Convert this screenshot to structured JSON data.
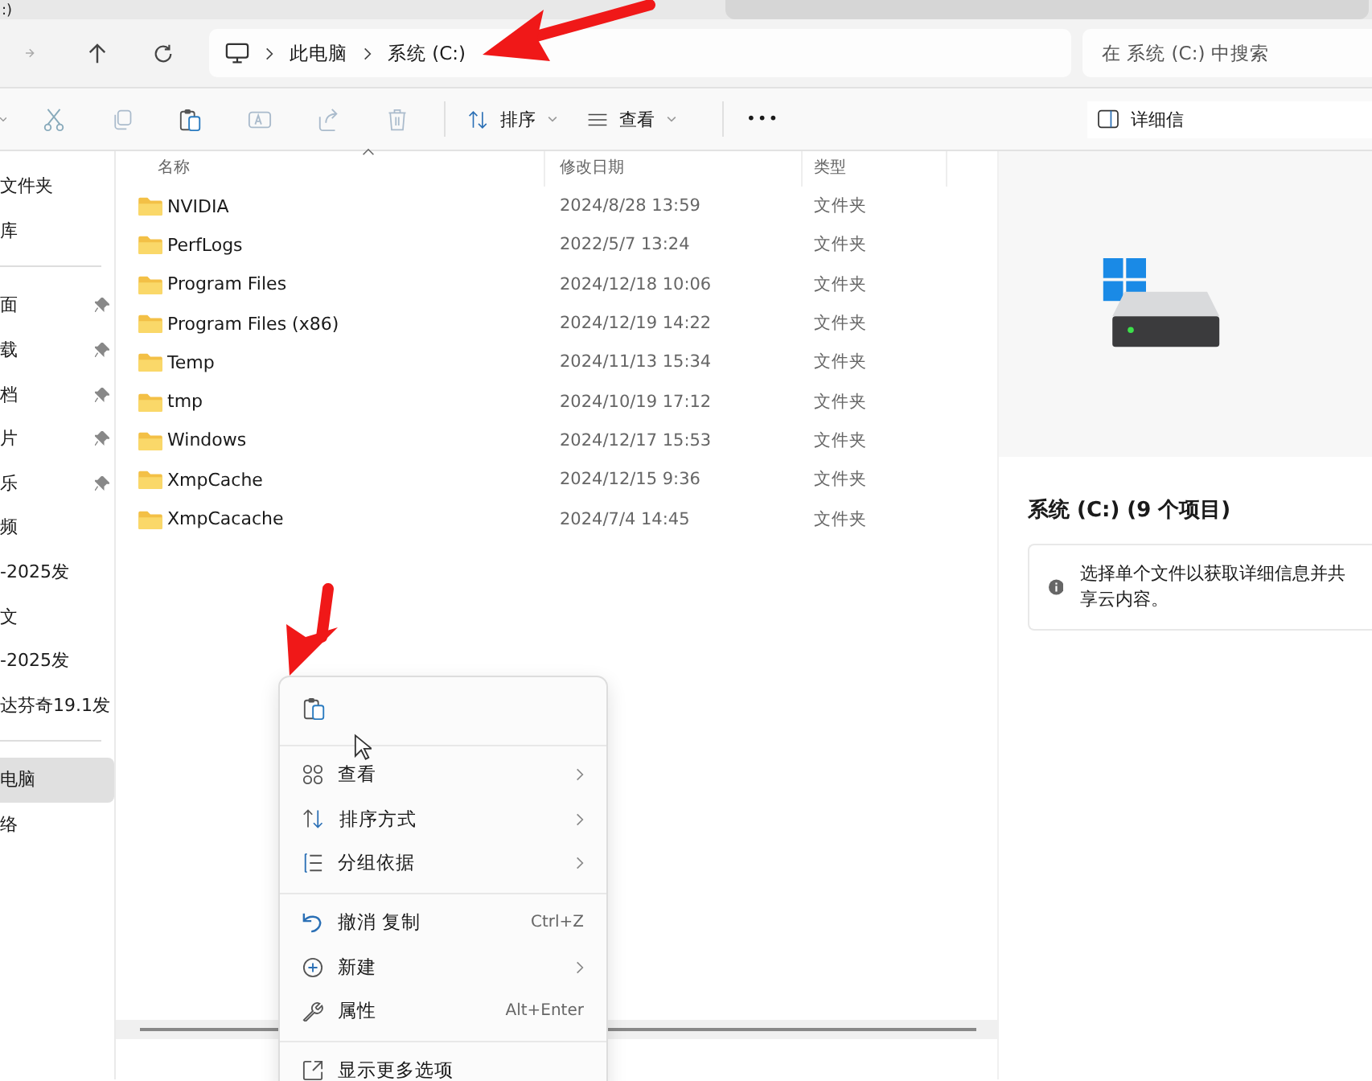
{
  "window": {
    "tab_title": ":)"
  },
  "address_bar": {
    "crumbs": [
      "此电脑",
      "系统 (C:)"
    ]
  },
  "search": {
    "placeholder": "在 系统 (C:) 中搜索"
  },
  "toolbar": {
    "sort": "排序",
    "view": "查看",
    "more": "•••",
    "details": "详细信"
  },
  "sidebar": {
    "sections": [
      [
        {
          "label": "文件夹",
          "pinned": false,
          "selected": false
        },
        {
          "label": "库",
          "pinned": false,
          "selected": false
        }
      ],
      [
        {
          "label": "面",
          "pinned": true,
          "selected": false
        },
        {
          "label": "载",
          "pinned": true,
          "selected": false
        },
        {
          "label": "档",
          "pinned": true,
          "selected": false
        },
        {
          "label": "片",
          "pinned": true,
          "selected": false
        },
        {
          "label": "乐",
          "pinned": true,
          "selected": false
        },
        {
          "label": "频",
          "pinned": false,
          "selected": false
        },
        {
          "label": "-2025发",
          "pinned": false,
          "selected": false
        },
        {
          "label": "文",
          "pinned": false,
          "selected": false
        },
        {
          "label": "-2025发",
          "pinned": false,
          "selected": false
        },
        {
          "label": "达芬奇19.1发",
          "pinned": false,
          "selected": false
        }
      ],
      [
        {
          "label": "电脑",
          "pinned": false,
          "selected": true
        },
        {
          "label": "络",
          "pinned": false,
          "selected": false
        }
      ]
    ]
  },
  "table": {
    "columns": [
      "名称",
      "修改日期",
      "类型"
    ],
    "rows": [
      [
        "NVIDIA",
        "2024/8/28 13:59",
        "文件夹"
      ],
      [
        "PerfLogs",
        "2022/5/7 13:24",
        "文件夹"
      ],
      [
        "Program Files",
        "2024/12/18 10:06",
        "文件夹"
      ],
      [
        "Program Files (x86)",
        "2024/12/19 14:22",
        "文件夹"
      ],
      [
        "Temp",
        "2024/11/13 15:34",
        "文件夹"
      ],
      [
        "tmp",
        "2024/10/19 17:12",
        "文件夹"
      ],
      [
        "Windows",
        "2024/12/17 15:53",
        "文件夹"
      ],
      [
        "XmpCache",
        "2024/12/15 9:36",
        "文件夹"
      ],
      [
        "XmpCacache",
        "2024/7/4 14:45",
        "文件夹"
      ]
    ]
  },
  "details_pane": {
    "title": "系统 (C:) (9 个项目)",
    "info": "选择单个文件以获取详细信息并共享云内容。"
  },
  "context_menu": {
    "groups": [
      [
        {
          "kind": "view",
          "label": "查看",
          "submenu": true
        },
        {
          "kind": "sort",
          "label": "排序方式",
          "submenu": true
        },
        {
          "kind": "group",
          "label": "分组依据",
          "submenu": true
        }
      ],
      [
        {
          "kind": "undo",
          "label": "撤消 复制",
          "shortcut": "Ctrl+Z",
          "submenu": false
        },
        {
          "kind": "new",
          "label": "新建",
          "submenu": true
        },
        {
          "kind": "properties",
          "label": "属性",
          "shortcut": "Alt+Enter",
          "submenu": false
        }
      ],
      [
        {
          "kind": "more",
          "label": "显示更多选项",
          "submenu": false
        }
      ]
    ]
  }
}
